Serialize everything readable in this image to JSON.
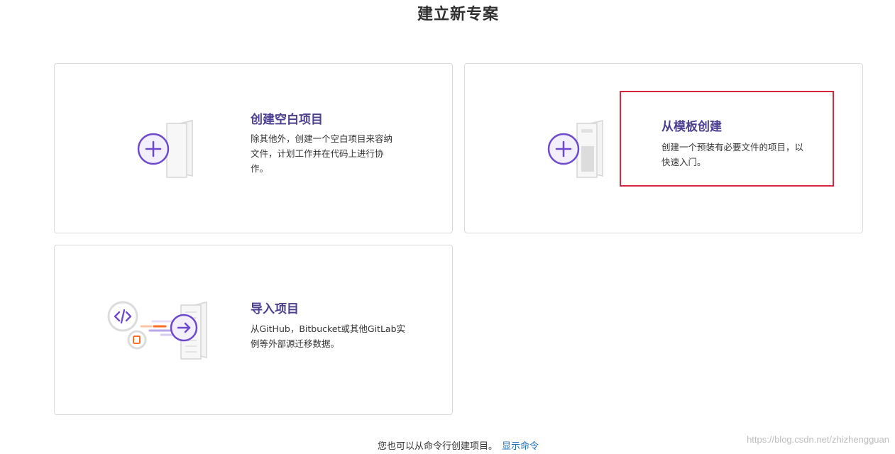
{
  "page": {
    "title": "建立新专案"
  },
  "cards": [
    {
      "title": "创建空白项目",
      "desc_lines": [
        "除其他外，创建一个空白项目来容纳",
        "文件，计划工作并在代码上进行协",
        "作。"
      ]
    },
    {
      "title": "从模板创建",
      "desc_lines": [
        "创建一个预装有必要文件的项目，以",
        "快速入门。"
      ]
    },
    {
      "title": "导入项目",
      "desc_lines": [
        "从GitHub，Bitbucket或其他GitLab实",
        "例等外部源迁移数据。"
      ]
    }
  ],
  "footer": {
    "text": "您也可以从命令行创建项目。",
    "link": "显示命令"
  },
  "watermark": "https://blog.csdn.net/zhizhengguan",
  "icons": [
    "plus-icon",
    "code-icon",
    "arrow-right-icon",
    "gitlab-icon"
  ],
  "colors": {
    "accent": "#6e49cb",
    "title": "#4b3f8f",
    "highlight": "#d7263d",
    "link": "#1f6fb5"
  }
}
